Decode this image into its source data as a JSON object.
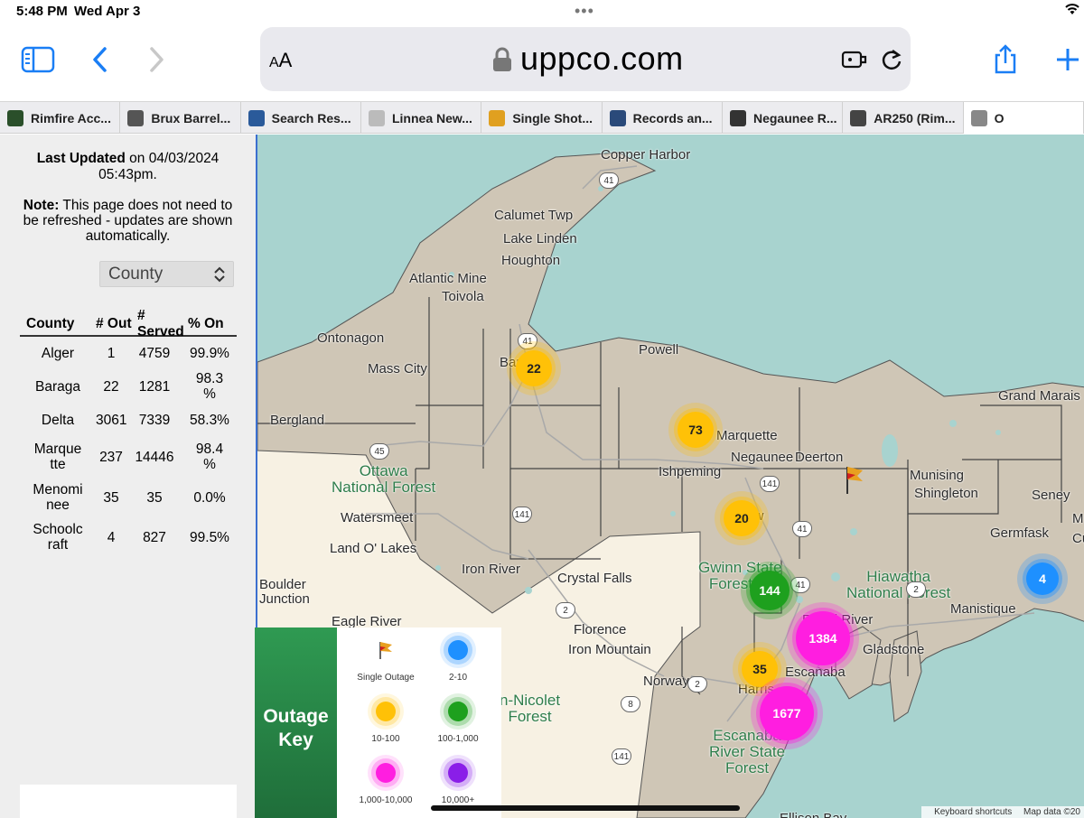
{
  "status": {
    "time": "5:48 PM",
    "date": "Wed Apr 3",
    "dots": "•••"
  },
  "toolbar": {
    "aa_small": "A",
    "aa_big": "A",
    "url": "uppco.com"
  },
  "tabs": [
    {
      "label": "Rimfire Acc...",
      "favicon": "target",
      "color": "#2a4f2a"
    },
    {
      "label": "Brux Barrel...",
      "favicon": "BRUX",
      "color": "#555555"
    },
    {
      "label": "Search Res...",
      "favicon": "GI",
      "color": "#2a5a9a"
    },
    {
      "label": "Linnea New...",
      "favicon": "circle",
      "color": "#bbbbbb"
    },
    {
      "label": "Single Shot...",
      "favicon": "GUN",
      "color": "#e0a020"
    },
    {
      "label": "Records an...",
      "favicon": "grid",
      "color": "#2a4a7a"
    },
    {
      "label": "Negaunee R...",
      "favicon": "logo",
      "color": "#333333"
    },
    {
      "label": "AR250 (Rim...",
      "favicon": "photo",
      "color": "#444444"
    },
    {
      "label": "O",
      "favicon": "x",
      "color": "#888888"
    }
  ],
  "panel": {
    "updated_bold": "Last Updated",
    "updated_rest": " on 04/03/2024",
    "updated_time": "05:43pm.",
    "note_bold": "Note:",
    "note_rest": " This page does not need to be refreshed - updates are shown automatically.",
    "select_value": "County"
  },
  "table": {
    "headers": [
      "County",
      "# Out",
      "# Served",
      "% On"
    ],
    "rows": [
      {
        "county": "Alger",
        "out": "1",
        "served": "4759",
        "on": "99.9%"
      },
      {
        "county": "Baraga",
        "out": "22",
        "served": "1281",
        "on": "98.3\n%"
      },
      {
        "county": "Delta",
        "out": "3061",
        "served": "7339",
        "on": "58.3%"
      },
      {
        "county": "Marque\ntte",
        "out": "237",
        "served": "14446",
        "on": "98.4\n%"
      },
      {
        "county": "Menomi\nnee",
        "out": "35",
        "served": "35",
        "on": "0.0%"
      },
      {
        "county": "Schoolc\nraft",
        "out": "4",
        "served": "827",
        "on": "99.5%"
      }
    ]
  },
  "map": {
    "places": [
      "Copper Harbor",
      "Calumet Twp",
      "Lake Linden",
      "Houghton",
      "Atlantic Mine",
      "Toivola",
      "Ontonagon",
      "Mass City",
      "Bar",
      "Powell",
      "Bergland",
      "Marquette",
      "Negaunee",
      "Ishpeming",
      "Deerton",
      "Munising",
      "Shingleton",
      "Grand Marais",
      "Seney",
      "Germfask",
      "Watersmeet",
      "Land O' Lakes",
      "Iron River",
      "Crystal Falls",
      "Gw",
      "Boulder\nJunction",
      "Eagle River",
      "Florence",
      "Iron Mountain",
      "Norway",
      "Rapid River",
      "Gladstone",
      "Escanaba",
      "Harris",
      "Manistique",
      "M",
      "Cu",
      "Ellison Bay"
    ],
    "forests": [
      "Ottawa\nNational Forest",
      "Gwinn State\nForest Ar",
      "Hiawatha\nNational Forest",
      "Escanaba\nRiver State\nForest",
      "n-Nicolet\nForest"
    ],
    "routes": [
      "41",
      "41",
      "45",
      "141",
      "141",
      "41",
      "41",
      "2",
      "2",
      "2",
      "8",
      "141"
    ],
    "clusters": [
      {
        "count": "22",
        "tier": "10-100"
      },
      {
        "count": "73",
        "tier": "10-100"
      },
      {
        "count": "20",
        "tier": "10-100"
      },
      {
        "count": "144",
        "tier": "100-1,000"
      },
      {
        "count": "4",
        "tier": "2-10"
      },
      {
        "count": "1384",
        "tier": "1,000-10,000"
      },
      {
        "count": "35",
        "tier": "10-100"
      },
      {
        "count": "1677",
        "tier": "1,000-10,000"
      }
    ],
    "footer_shortcuts": "Keyboard shortcuts",
    "footer_data": "Map data ©20"
  },
  "key": {
    "title": "Outage\nKey",
    "items": [
      {
        "label": "Single Outage",
        "color": "#e8a020"
      },
      {
        "label": "2-10",
        "color": "#1e90ff"
      },
      {
        "label": "10-100",
        "color": "#ffc107"
      },
      {
        "label": "100-1,000",
        "color": "#1ea01e"
      },
      {
        "label": "1,000-10,000",
        "color": "#ff1ee0"
      },
      {
        "label": "10,000+",
        "color": "#8a1ee8"
      }
    ]
  },
  "colors": {
    "accent": "#1a7ef5",
    "land": "#cfc6b6",
    "lake": "#a8d3cf",
    "outside": "#f7f1e3"
  }
}
